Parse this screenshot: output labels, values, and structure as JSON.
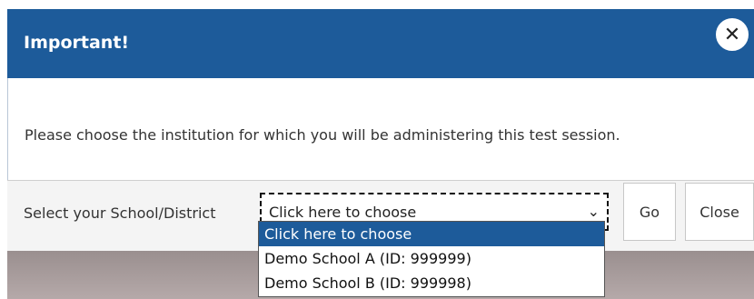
{
  "modal": {
    "title": "Important!",
    "close_icon_glyph": "✕",
    "message": "Please choose the institution for which you will be administering this test session.",
    "select_label": "Select your School/District",
    "select_value": "Click here to choose",
    "chevron_glyph": "⌄",
    "go_label": "Go",
    "close_label": "Close"
  },
  "dropdown": {
    "options": [
      {
        "label": "Click here to choose",
        "selected": true
      },
      {
        "label": "Demo School A  (ID: 999999)",
        "selected": false
      },
      {
        "label": "Demo School B  (ID: 999998)",
        "selected": false
      }
    ]
  },
  "colors": {
    "header": "#1d5b9a",
    "selected_option": "#1d5b9a",
    "backdrop": "#9a8f8f"
  },
  "icons": {
    "close": "close-icon",
    "dropdown": "chevron-down-icon"
  }
}
